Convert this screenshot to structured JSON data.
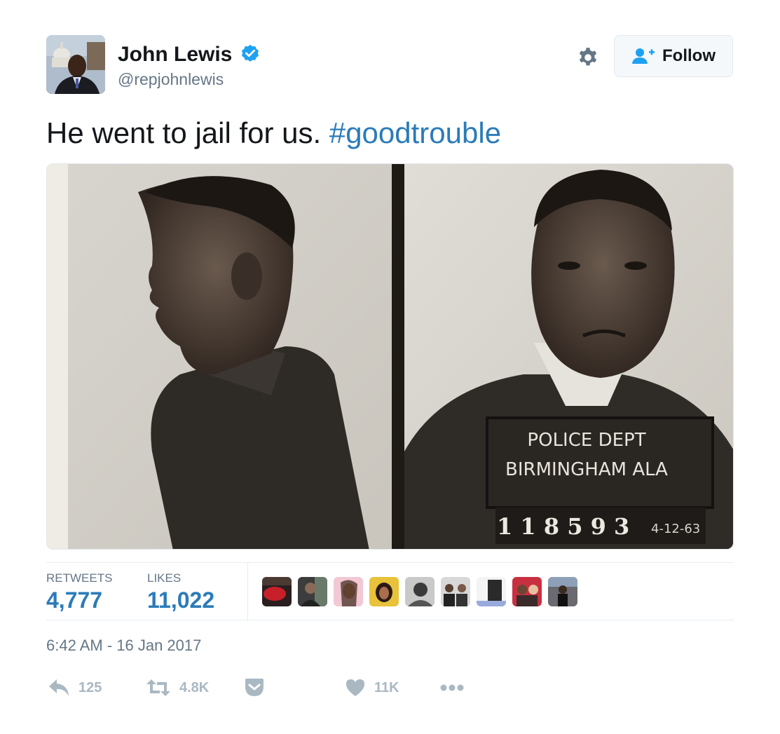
{
  "author": {
    "name": "John Lewis",
    "handle": "@repjohnlewis",
    "verified_icon": "verified-badge-icon"
  },
  "header": {
    "settings_icon": "gear-icon",
    "follow_label": "Follow",
    "follow_icon": "add-user-icon"
  },
  "tweet": {
    "text": "He went to jail for us.",
    "hashtag": "#goodtrouble",
    "photo": {
      "placard_line1": "POLICE DEPT",
      "placard_line2": "BIRMINGHAM  ALA",
      "placard_number": "1 1 8 5 9 3",
      "placard_date": "4-12-63"
    }
  },
  "stats": {
    "retweets_label": "RETWEETS",
    "retweets_value": "4,777",
    "likes_label": "LIKES",
    "likes_value": "11,022",
    "liker_count": 9
  },
  "timestamp": "6:42 AM - 16 Jan 2017",
  "actions": {
    "reply": {
      "icon": "reply-icon",
      "count": "125"
    },
    "retweet": {
      "icon": "retweet-icon",
      "count": "4.8K"
    },
    "pocket": {
      "icon": "pocket-icon"
    },
    "like": {
      "icon": "heart-icon",
      "count": "11K"
    },
    "more": {
      "icon": "more-dots-icon"
    }
  },
  "colors": {
    "link": "#2b7bb9",
    "text": "#14171a",
    "muted": "#657786",
    "action": "#aab8c2",
    "verified": "#1da1f2"
  }
}
